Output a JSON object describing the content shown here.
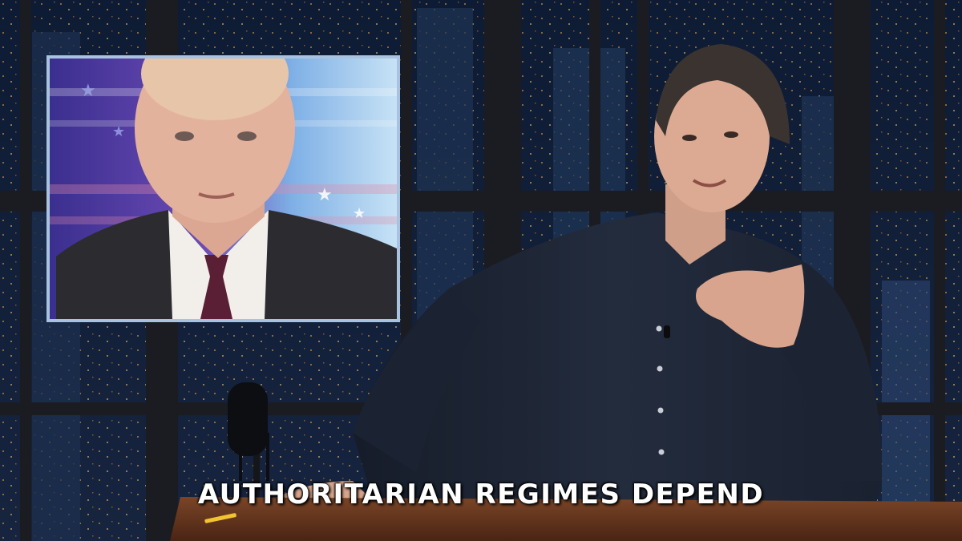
{
  "caption": {
    "text": "AUTHORITARIAN REGIMES DEPEND"
  },
  "colors": {
    "night_sky": "#0d1b33",
    "window_grid": "#1c1f26",
    "city_light": "#e9a542",
    "shirt": "#1d2433",
    "desk": "#6b3a22",
    "inset_frame": "#a9c2df"
  }
}
